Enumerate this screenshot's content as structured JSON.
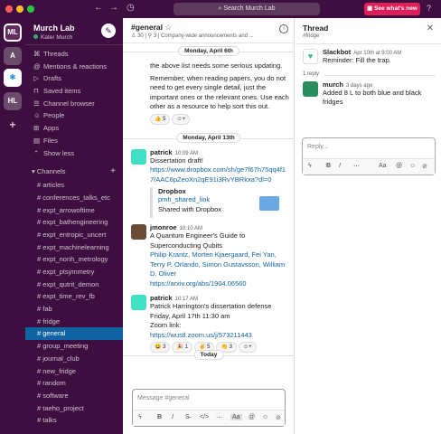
{
  "window": {
    "search_placeholder": "Search Murch Lab",
    "whats_new": "See what's new",
    "help": "?"
  },
  "workspaces": [
    "ML",
    "A",
    "HL"
  ],
  "sidebar": {
    "title": "Murch Lab",
    "user": "Kater Murch",
    "nav": [
      "Threads",
      "Mentions & reactions",
      "Drafts",
      "Saved items",
      "Channel browser",
      "People",
      "Apps",
      "Files",
      "Show less"
    ],
    "channels_label": "Channels",
    "channels": [
      "articles",
      "conferences_talks_etc",
      "expt_arrowoftime",
      "expt_bathengineering",
      "expt_entropic_uncert",
      "expt_machinelearning",
      "expt_nonh_metrology",
      "expt_ptsymmetry",
      "expt_qutrit_demon",
      "expt_time_rev_fb",
      "fab",
      "fridge",
      "general",
      "group_meeting",
      "journal_club",
      "new_fridge",
      "random",
      "software",
      "taeho_project",
      "talks"
    ],
    "active_channel": "general"
  },
  "channel": {
    "name": "#general",
    "members": "30",
    "pins": "3",
    "topic": "Company-wide announcements and ..."
  },
  "messages": {
    "day1": "Monday, April 6th",
    "partial": [
      "the above list needs some serious updating.",
      "Remember, when reading papers, you do not need to get every single detail, just the important ones or the relevant ones. Use each other as a resource to help sort this out."
    ],
    "react1": "5",
    "day2": "Monday, April 13th",
    "m1": {
      "author": "patrick",
      "time": "10:09 AM",
      "text": "Dissertation draft!",
      "link": "https://www.dropbox.com/sh/ge7f67h75qq4f17/AAC6pZeoXn2qE91i3RvYBRkxa?dl=0",
      "attach_title": "Dropbox",
      "attach_link": "pmh_shared_link",
      "attach_sub": "Shared with Dropbox"
    },
    "m2": {
      "author": "jmonroe",
      "time": "10:10 AM",
      "text": "A Quantum Engineer's Guide to Superconducting Qubits",
      "authors": "Philip Krantz, Morten Kjaergaard, Fei Yan, Terry P. Orlando, Simon Gustavsson, William D. Oliver",
      "link": "https://arxiv.org/abs/1904.06560"
    },
    "m3": {
      "author": "patrick",
      "time": "10:17 AM",
      "text1": "Patrick Harrington's dissertation defense",
      "text2": "Friday, April 17th 11:30 am",
      "text3": "Zoom link:",
      "link": "https://wustl.zoom.us/j/573211443",
      "reacts": [
        "3",
        "1",
        "5",
        "3"
      ]
    },
    "today": "Today"
  },
  "composer": {
    "placeholder": "Message #general"
  },
  "thread": {
    "title": "Thread",
    "channel": "#fridge",
    "parent": {
      "author": "Slackbot",
      "time": "Apr 10th at 9:00 AM",
      "text": "Reminder: Fill the trap."
    },
    "replies_label": "1 reply",
    "reply": {
      "author": "murch",
      "time": "3 days ago",
      "text": "Added 8 L to both blue and black fridges"
    },
    "reply_placeholder": "Reply..."
  },
  "colors": {
    "aubergine": "#3f0e40",
    "active": "#1164a3",
    "link": "#1264a3",
    "whats_new": "#e01e5a",
    "patrick_avatar": "#3fe0c5",
    "murch_avatar": "#2b8c5e"
  }
}
